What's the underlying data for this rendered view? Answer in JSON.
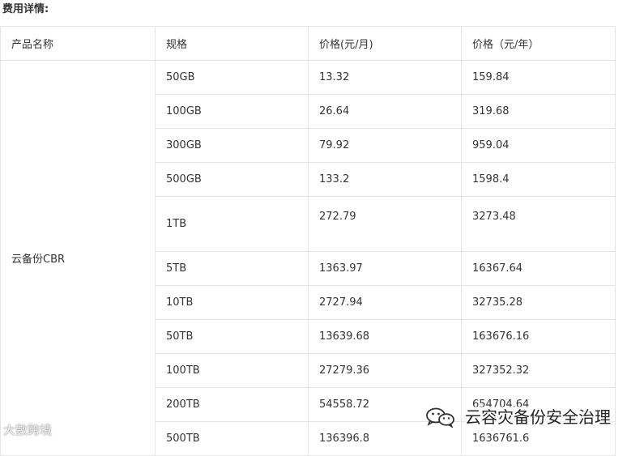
{
  "heading": "费用详情:",
  "table": {
    "headers": [
      "产品名称",
      "规格",
      "价格(元/月)",
      "价格（元/年）"
    ],
    "product": "云备份CBR",
    "rows": [
      {
        "spec": "50GB",
        "monthly": "13.32",
        "yearly": "159.84"
      },
      {
        "spec": "100GB",
        "monthly": "26.64",
        "yearly": "319.68"
      },
      {
        "spec": "300GB",
        "monthly": "79.92",
        "yearly": "959.04"
      },
      {
        "spec": "500GB",
        "monthly": "133.2",
        "yearly": "1598.4"
      },
      {
        "spec": "1TB",
        "monthly": "272.79",
        "yearly": "3273.48"
      },
      {
        "spec": "5TB",
        "monthly": "1363.97",
        "yearly": "16367.64"
      },
      {
        "spec": "10TB",
        "monthly": "2727.94",
        "yearly": "32735.28"
      },
      {
        "spec": "50TB",
        "monthly": "13639.68",
        "yearly": "163676.16"
      },
      {
        "spec": "100TB",
        "monthly": "27279.36",
        "yearly": "327352.32"
      },
      {
        "spec": "200TB",
        "monthly": "54558.72",
        "yearly": "654704.64"
      },
      {
        "spec": "500TB",
        "monthly": "136396.8",
        "yearly": "1636761.6"
      }
    ]
  },
  "watermarks": {
    "left": "大數跨境",
    "right": "云容灾备份安全治理",
    "icon": "wechat-icon"
  }
}
